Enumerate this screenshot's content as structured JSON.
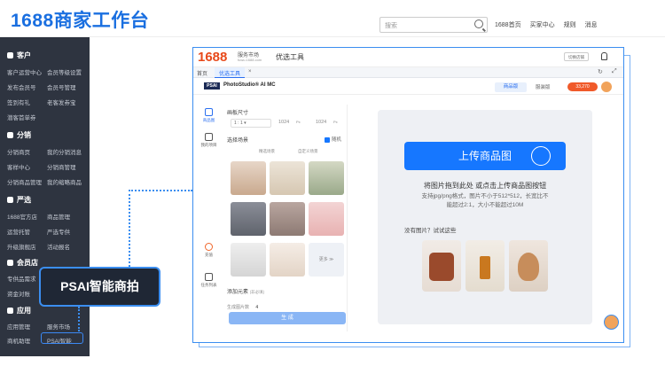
{
  "header": {
    "logo": "1688商家工作台",
    "search_placeholder": "搜索",
    "links": [
      "1688首页",
      "买家中心",
      "规则",
      "消息"
    ]
  },
  "sidebar": {
    "sections": [
      {
        "title": "客户",
        "links": [
          "客户运营中心",
          "会员等级设置",
          "发布会员号",
          "会员号管理",
          "签到有礼",
          "老客发券宝",
          "潜客首单券"
        ]
      },
      {
        "title": "分销",
        "links": [
          "分销商页",
          "我的分销消息",
          "客样中心",
          "分销商管理",
          "分销商品管理",
          "我的缩略商品"
        ]
      },
      {
        "title": "严选",
        "links": [
          "1688官方店",
          "商品管理",
          "运营托管",
          "严选专供",
          "升级旗舰店",
          "活动报名"
        ]
      },
      {
        "title": "会员店",
        "links": [
          "专供品需求",
          "资金对账"
        ]
      },
      {
        "title": "应用",
        "links": [
          "应用管理",
          "服务市场",
          "商机助理",
          "PSAI智能"
        ]
      }
    ]
  },
  "inner": {
    "logo": "1688",
    "service_market": "服务市场",
    "service_url": "fuwu.1688.com",
    "tool_title": "优选工具",
    "switch_store": "切换店铺",
    "tabs": {
      "home": "首页",
      "active": "优选工具",
      "close": "×"
    },
    "app_name": "PhotoStudio® AI MC",
    "app_logo": "PSAI",
    "version_tabs": [
      "商品版",
      "服装版"
    ],
    "points": "33,270"
  },
  "leftnav": [
    {
      "label": "商品图"
    },
    {
      "label": "我的项目"
    },
    {
      "label": "充值"
    },
    {
      "label": "任务列表"
    }
  ],
  "panel": {
    "canvas_size_label": "画板尺寸",
    "ratio": "1 : 1",
    "width": "1024",
    "height": "1024",
    "unit": "Px",
    "scene_label": "选择场景",
    "random_label": "随机",
    "scene_tabs": [
      "精选场景",
      "自定义场景"
    ],
    "thumbs": [
      "",
      "",
      "",
      "",
      "",
      "",
      "",
      ""
    ],
    "more_label": "更多 ≫",
    "add_element_label": "添加元素",
    "add_element_hint": "(非必填)",
    "gen_count_label": "生成图片数",
    "gen_count": "4",
    "gen_button": "生 成"
  },
  "upload": {
    "button": "上传商品图",
    "drop_text": "将图片拖到此处 或点击上传商品图按钮",
    "hint_line1": "支持jpg/png格式，图片不小于512*512，长宽比不",
    "hint_line2": "能超过2:1，大小不能超过10M",
    "try_label": "没有图片？试试这些"
  },
  "callout": {
    "label": "PSAI智能商拍"
  },
  "colors": {
    "accent": "#1677ff",
    "sidebar_bg": "#2e3440",
    "frame_border": "#3b8ef0"
  }
}
